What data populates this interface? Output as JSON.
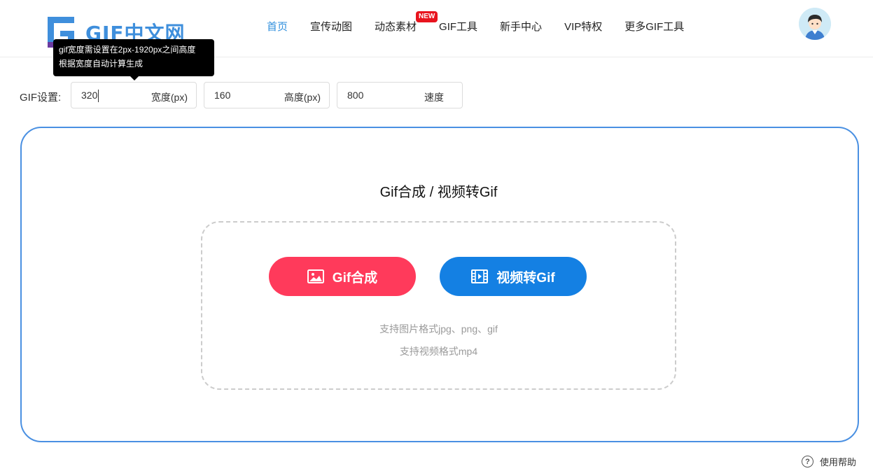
{
  "header": {
    "logo_text": "GIF中文网",
    "nav": [
      {
        "label": "首页"
      },
      {
        "label": "宣传动图"
      },
      {
        "label": "动态素材"
      },
      {
        "label": "GIF工具"
      },
      {
        "label": "新手中心"
      },
      {
        "label": "VIP特权"
      },
      {
        "label": "更多GIF工具"
      }
    ],
    "new_badge": "NEW"
  },
  "tooltip": {
    "line1": "gif宽度需设置在2px-1920px之间高度",
    "line2": "根据宽度自动计算生成"
  },
  "settings": {
    "label": "GIF设置:",
    "width": {
      "value": "320",
      "unit": "宽度(px)"
    },
    "height": {
      "value": "160",
      "unit": "高度(px)"
    },
    "speed": {
      "value": "800",
      "unit": "速度"
    }
  },
  "main": {
    "title": "Gif合成 / 视频转Gif",
    "gif_button": "Gif合成",
    "video_button": "视频转Gif",
    "hint_images": "支持图片格式jpg、png、gif",
    "hint_video": "支持视频格式mp4"
  },
  "help": {
    "label": "使用帮助"
  },
  "colors": {
    "accent": "#4a90e2",
    "gif_button": "#ff3a5b",
    "video_button": "#1480e3",
    "nav_active": "#2f8fdd",
    "badge": "#e8141e"
  }
}
